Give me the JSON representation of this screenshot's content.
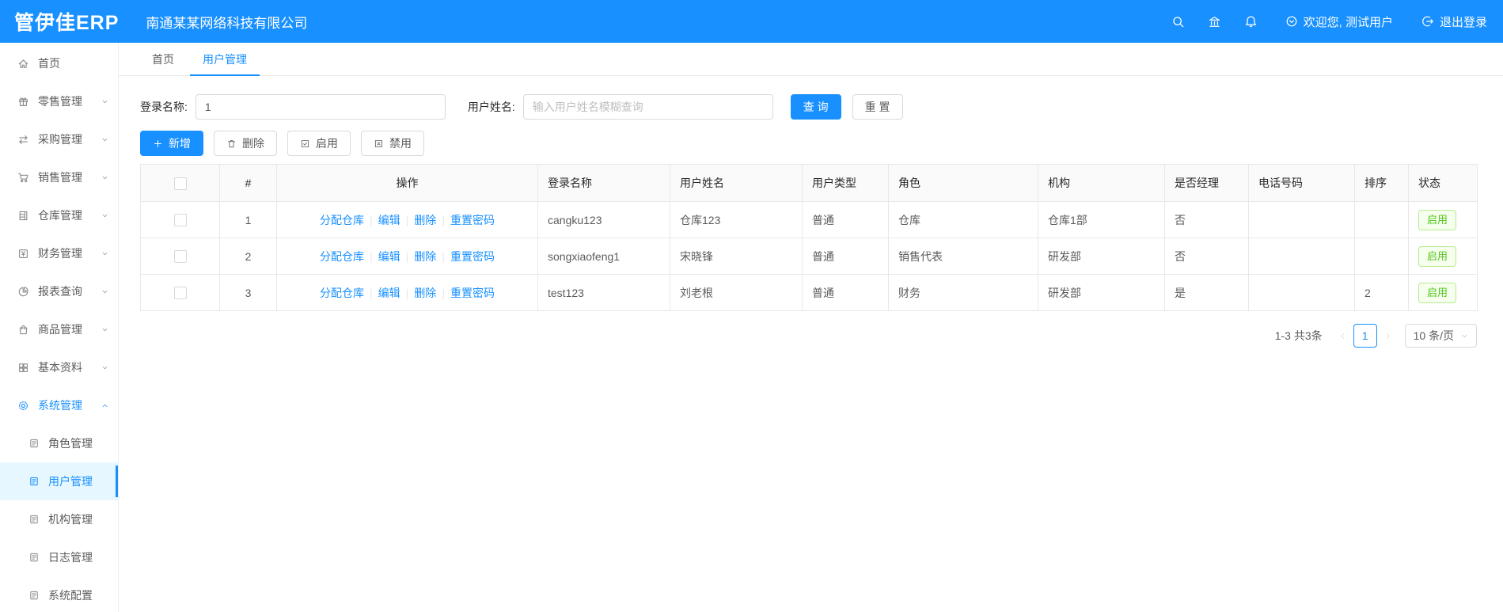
{
  "app": {
    "logo_text": "管伊佳ERP",
    "company_name": "南通某某网络科技有限公司",
    "welcome_text": "欢迎您, 测试用户",
    "logout_text": "退出登录"
  },
  "colors": {
    "primary": "#1890ff",
    "success_text": "#52c41a",
    "success_bg": "#f6ffed",
    "success_border": "#b7eb8f",
    "active_item_bg": "#e6f7ff"
  },
  "header_icons": [
    "search-icon",
    "bank-icon",
    "bell-icon",
    "down-circle-icon",
    "logout-icon"
  ],
  "sidebar": {
    "items": [
      {
        "key": "home",
        "label": "首页",
        "icon": "home-icon",
        "expandable": false
      },
      {
        "key": "retail",
        "label": "零售管理",
        "icon": "retail-gift-icon",
        "expandable": true
      },
      {
        "key": "purchase",
        "label": "采购管理",
        "icon": "purchase-swap-icon",
        "expandable": true
      },
      {
        "key": "sale",
        "label": "销售管理",
        "icon": "sales-cart-icon",
        "expandable": true
      },
      {
        "key": "depot",
        "label": "仓库管理",
        "icon": "warehouse-icon",
        "expandable": true
      },
      {
        "key": "finance",
        "label": "财务管理",
        "icon": "finance-icon",
        "expandable": true
      },
      {
        "key": "report",
        "label": "报表查询",
        "icon": "report-pie-icon",
        "expandable": true
      },
      {
        "key": "material",
        "label": "商品管理",
        "icon": "goods-bag-icon",
        "expandable": true
      },
      {
        "key": "basedata",
        "label": "基本资料",
        "icon": "basedata-grid-icon",
        "expandable": true
      },
      {
        "key": "system",
        "label": "系统管理",
        "icon": "gear-icon",
        "expandable": true,
        "expanded": true,
        "active": true,
        "children": [
          {
            "key": "role",
            "label": "角色管理",
            "icon": "doc-icon",
            "active": false
          },
          {
            "key": "user",
            "label": "用户管理",
            "icon": "doc-icon",
            "active": true
          },
          {
            "key": "organization",
            "label": "机构管理",
            "icon": "doc-icon",
            "active": false
          },
          {
            "key": "log",
            "label": "日志管理",
            "icon": "doc-icon",
            "active": false
          },
          {
            "key": "config",
            "label": "系统配置",
            "icon": "doc-icon",
            "active": false
          }
        ]
      }
    ]
  },
  "tabs": [
    {
      "key": "home",
      "label": "首页",
      "active": false
    },
    {
      "key": "user-management",
      "label": "用户管理",
      "active": true
    }
  ],
  "filters": {
    "login_name_label": "登录名称:",
    "login_name_value": "1",
    "user_name_label": "用户姓名:",
    "user_name_placeholder": "输入用户姓名模糊查询",
    "search_button": "查 询",
    "reset_button": "重 置"
  },
  "toolbar": {
    "buttons": [
      {
        "key": "add",
        "label": "新增",
        "icon": "plus-icon",
        "primary": true
      },
      {
        "key": "delete",
        "label": "删除",
        "icon": "trash-icon",
        "primary": false
      },
      {
        "key": "enable",
        "label": "启用",
        "icon": "check-square-icon",
        "primary": false
      },
      {
        "key": "disable",
        "label": "禁用",
        "icon": "close-square-icon",
        "primary": false
      }
    ]
  },
  "table": {
    "columns": [
      "#",
      "操作",
      "登录名称",
      "用户姓名",
      "用户类型",
      "角色",
      "机构",
      "是否经理",
      "电话号码",
      "排序",
      "状态"
    ],
    "action_links": [
      "分配仓库",
      "编辑",
      "删除",
      "重置密码"
    ],
    "rows": [
      {
        "index": "1",
        "login_name": "cangku123",
        "user_name": "仓库123",
        "user_type": "普通",
        "role": "仓库",
        "org": "仓库1部",
        "is_manager": "否",
        "phone": "",
        "sort": "",
        "status": "启用"
      },
      {
        "index": "2",
        "login_name": "songxiaofeng1",
        "user_name": "宋晓锋",
        "user_type": "普通",
        "role": "销售代表",
        "org": "研发部",
        "is_manager": "否",
        "phone": "",
        "sort": "",
        "status": "启用"
      },
      {
        "index": "3",
        "login_name": "test123",
        "user_name": "刘老根",
        "user_type": "普通",
        "role": "财务",
        "org": "研发部",
        "is_manager": "是",
        "phone": "",
        "sort": "2",
        "status": "启用"
      }
    ]
  },
  "pagination": {
    "total_text": "1-3 共3条",
    "current_page": "1",
    "page_size_text": "10 条/页"
  }
}
